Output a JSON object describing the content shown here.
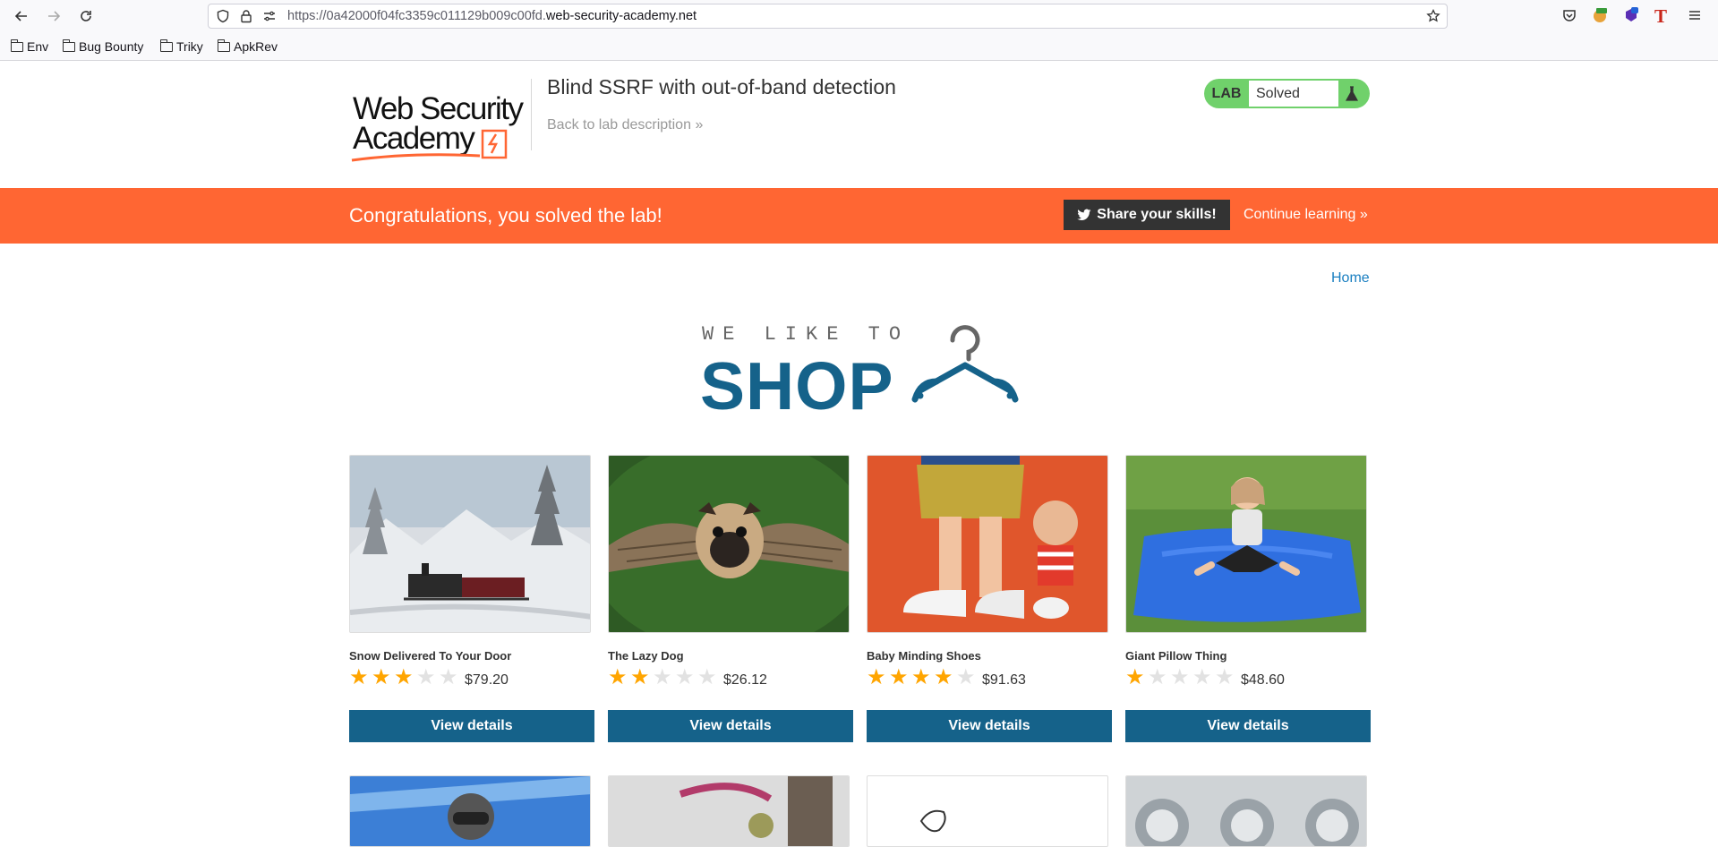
{
  "browser": {
    "url_prefix": "https://0a42000f04fc3359c011129b009c00fd.",
    "url_domain": "web-security-academy.net",
    "bookmarks": [
      "Env",
      "Bug Bounty",
      "Triky",
      "ApkRev"
    ]
  },
  "header": {
    "logo_line1": "Web Security",
    "logo_line2": "Academy",
    "lab_title": "Blind SSRF with out-of-band detection",
    "back_link": "Back to lab description",
    "status_label": "LAB",
    "status_value": "Solved"
  },
  "banner": {
    "message": "Congratulations, you solved the lab!",
    "share_label": "Share your skills!",
    "continue_label": "Continue learning"
  },
  "nav": {
    "home": "Home"
  },
  "shop_logo": {
    "tagline": "WE LIKE TO",
    "word": "SHOP"
  },
  "products": [
    {
      "name": "Snow Delivered To Your Door",
      "rating": 3,
      "price": "$79.20",
      "button": "View details"
    },
    {
      "name": "The Lazy Dog",
      "rating": 2,
      "price": "$26.12",
      "button": "View details"
    },
    {
      "name": "Baby Minding Shoes",
      "rating": 4,
      "price": "$91.63",
      "button": "View details"
    },
    {
      "name": "Giant Pillow Thing",
      "rating": 1,
      "price": "$48.60",
      "button": "View details"
    }
  ],
  "colors": {
    "accent": "#15628a",
    "banner": "#ff6633",
    "solved": "#70d16b",
    "star": "#ffa500"
  }
}
